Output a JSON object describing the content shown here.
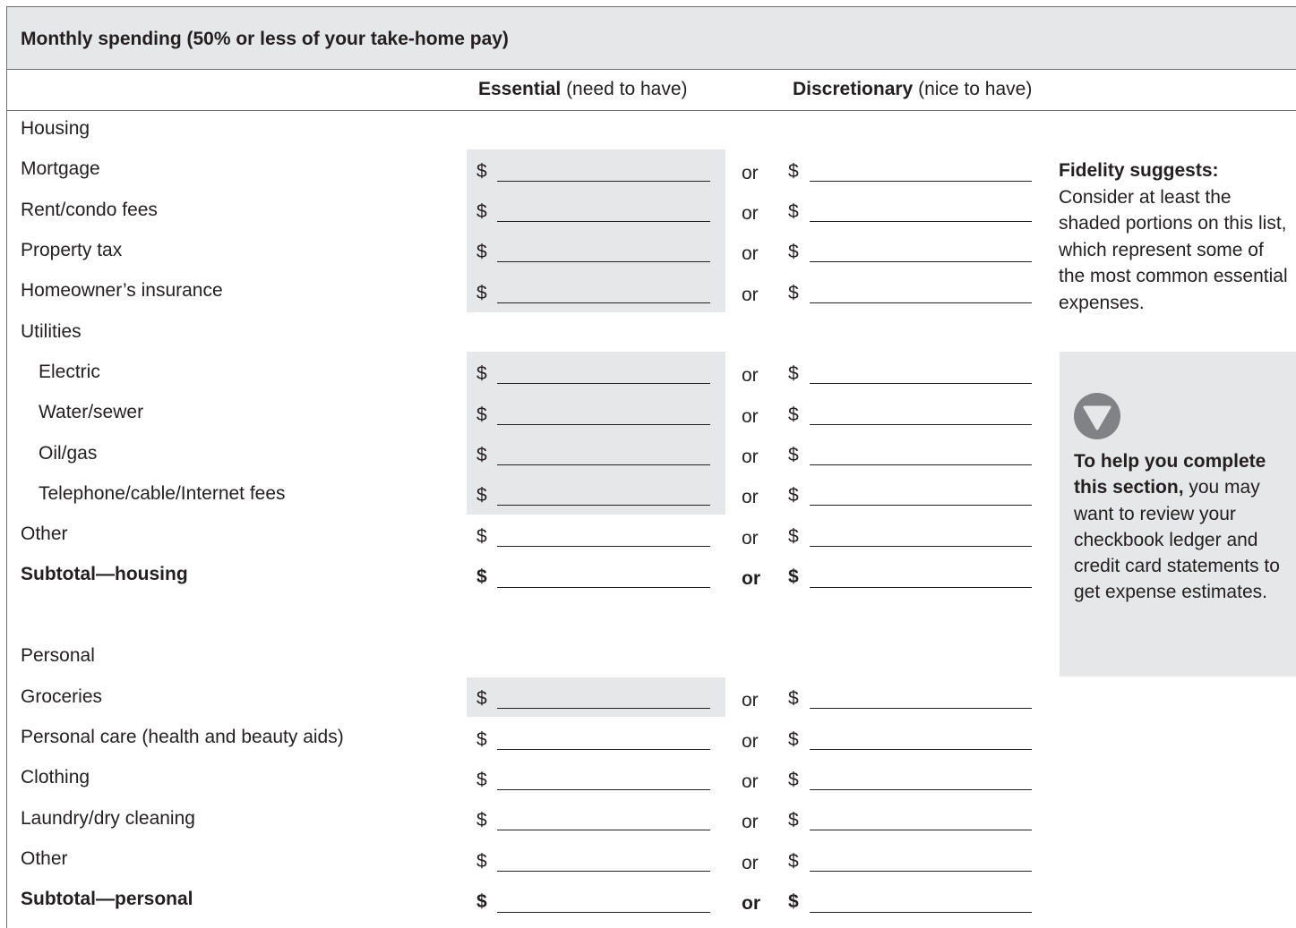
{
  "header": {
    "title": "Monthly spending (50% or less of your take-home pay)"
  },
  "columns": {
    "essential": {
      "label": "Essential",
      "note": "(need to have)"
    },
    "discretionary": {
      "label": "Discretionary",
      "note": "(nice to have)"
    }
  },
  "form": {
    "dollar_sign": "$",
    "or_label": "or",
    "sections": [
      {
        "title": "Housing"
      },
      {
        "title": "Personal"
      }
    ],
    "rows": [
      {
        "label": "Mortgage"
      },
      {
        "label": "Rent/condo fees"
      },
      {
        "label": "Property tax"
      },
      {
        "label": "Homeowner’s insurance"
      },
      {
        "label": "Utilities"
      },
      {
        "label": "Electric"
      },
      {
        "label": "Water/sewer"
      },
      {
        "label": "Oil/gas"
      },
      {
        "label": "Telephone/cable/Internet fees"
      },
      {
        "label": "Other"
      },
      {
        "label": "Subtotal—housing"
      },
      {
        "label": "Groceries"
      },
      {
        "label": "Personal care (health and beauty aids)"
      },
      {
        "label": "Clothing"
      },
      {
        "label": "Laundry/dry cleaning"
      },
      {
        "label": "Other"
      },
      {
        "label": "Subtotal—personal"
      }
    ]
  },
  "sidebar": {
    "suggest_title": "Fidelity suggests:",
    "suggest_body": "Consider at least the shaded portions on this list, which represent some of the most common essential expenses.",
    "tip_lead": "To help you complete this section,",
    "tip_body": " you may want to review your checkbook ledger and credit card statements to get expense estimates.",
    "tip_icon": "down-triangle-circle-icon"
  }
}
